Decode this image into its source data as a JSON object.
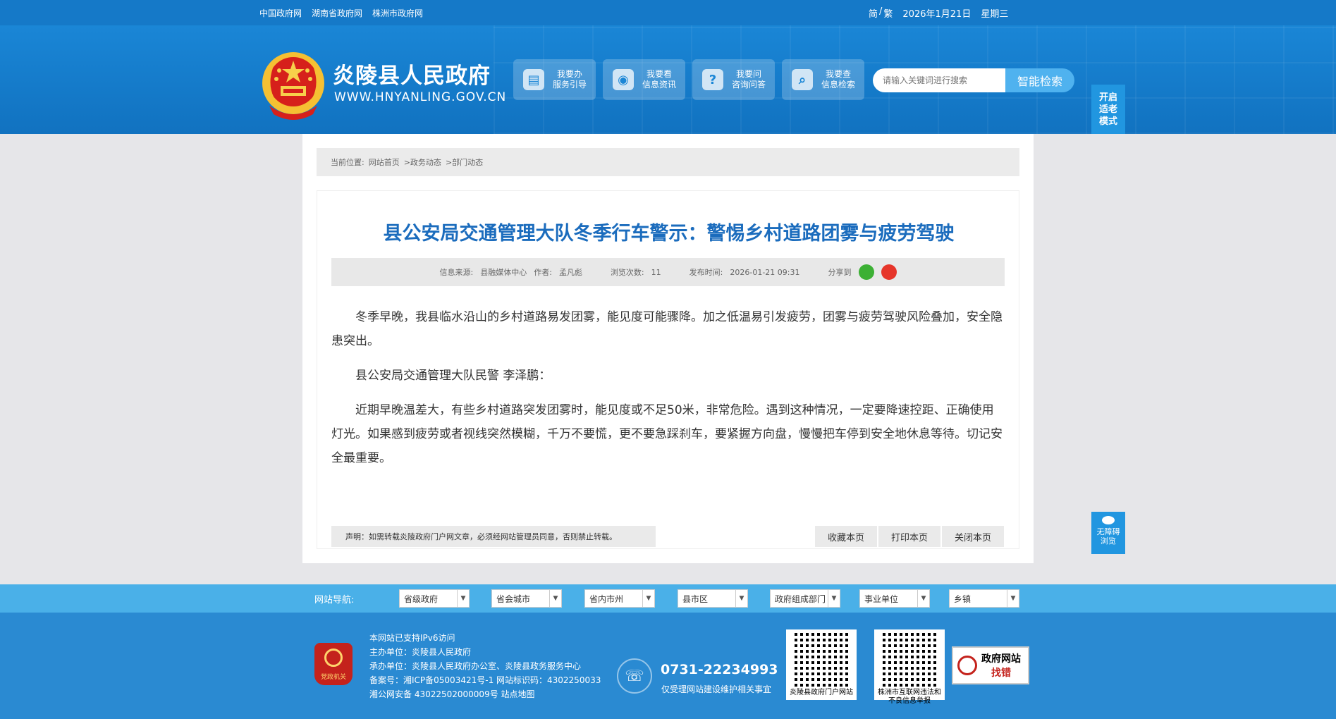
{
  "topbar": {
    "links": [
      "中国政府网",
      "湖南省政府网",
      "株洲市政府网"
    ],
    "lang_simplified": "简",
    "lang_sep": "/",
    "lang_traditional": "繁",
    "date": "2026年1月21日",
    "weekday": "星期三"
  },
  "header": {
    "site_name": "炎陵县人民政府",
    "site_domain": "WWW.HNYANLING.GOV.CN",
    "services": [
      {
        "line1": "我要办",
        "line2": "服务引导",
        "icon": "document-icon"
      },
      {
        "line1": "我要看",
        "line2": "信息资讯",
        "icon": "eye-icon"
      },
      {
        "line1": "我要问",
        "line2": "咨询问答",
        "icon": "question-icon"
      },
      {
        "line1": "我要查",
        "line2": "信息检索",
        "icon": "search-icon"
      }
    ],
    "search_placeholder": "请输入关键词进行搜索",
    "search_button": "智能检索",
    "elder_mode": [
      "开启",
      "适老",
      "模式"
    ]
  },
  "breadcrumb": {
    "label": "当前位置:",
    "items": [
      "网站首页",
      ">政务动态",
      ">部门动态"
    ]
  },
  "article": {
    "title": "县公安局交通管理大队冬季行车警示：警惕乡村道路团雾与疲劳驾驶",
    "source_label": "信息来源:",
    "source": "县融媒体中心",
    "author_label": "作者:",
    "author": "孟凡彪",
    "views_label": "浏览次数:",
    "views": "11",
    "time_label": "发布时间:",
    "time": "2026-01-21 09:31",
    "share_label": "分享到",
    "paragraphs": [
      "冬季早晚，我县临水沿山的乡村道路易发团雾，能见度可能骤降。加之低温易引发疲劳，团雾与疲劳驾驶风险叠加，安全隐患突出。",
      "县公安局交通管理大队民警 李泽鹏：",
      "近期早晚温差大，有些乡村道路突发团雾时，能见度或不足50米，非常危险。遇到这种情况，一定要降速控距、正确使用灯光。如果感到疲劳或者视线突然模糊，千万不要慌，更不要急踩刹车，要紧握方向盘，慢慢把车停到安全地休息等待。切记安全最重要。"
    ],
    "notice": "声明：如需转载炎陵政府门户网文章，必须经网站管理员同意，否则禁止转载。",
    "actions": [
      "收藏本页",
      "打印本页",
      "关闭本页"
    ]
  },
  "accessibility": {
    "line1": "无障碍",
    "line2": "浏览"
  },
  "navbar": {
    "label": "网站导航:",
    "selects": [
      "省级政府",
      "省会城市",
      "省内市州",
      "县市区",
      "政府组成部门",
      "事业单位",
      "乡镇"
    ]
  },
  "footer": {
    "party_label": "党政机关",
    "info": [
      "本网站已支持IPv6访问",
      "主办单位：炎陵县人民政府",
      "承办单位：炎陵县人民政府办公室、炎陵县政务服务中心",
      "备案号：湘ICP备05003421号-1 网站标识码：4302250033",
      "湘公网安备 43022502000009号 站点地图"
    ],
    "phone": "0731-22234993",
    "phone_note": "仅受理网站建设维护相关事宜",
    "qr1_caption": "炎陵县政府门户网站",
    "qr2_caption": "株洲市互联网违法和不良信息举报",
    "findbug_line1": "政府网站",
    "findbug_line2": "找错"
  },
  "colors": {
    "topbar": "#1579c8",
    "header": "#1a86d6",
    "title": "#1b6cbd",
    "navbar": "#4ab0e8",
    "footer": "#2a8ad2"
  }
}
